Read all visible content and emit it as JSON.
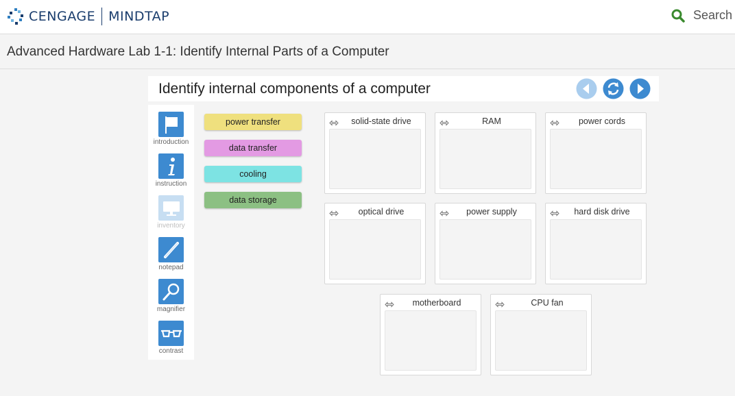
{
  "brand": {
    "name": "CENGAGE",
    "product": "MINDTAP"
  },
  "search": {
    "label": "Search"
  },
  "page": {
    "title": "Advanced Hardware Lab 1-1: Identify Internal Parts of a Computer"
  },
  "activity": {
    "title": "Identify internal components of a computer"
  },
  "tools": [
    {
      "label": "introduction",
      "icon": "flag-icon",
      "enabled": true
    },
    {
      "label": "instruction",
      "icon": "info-icon",
      "enabled": true
    },
    {
      "label": "inventory",
      "icon": "monitor-icon",
      "enabled": false
    },
    {
      "label": "notepad",
      "icon": "pencil-icon",
      "enabled": true
    },
    {
      "label": "magnifier",
      "icon": "magnifier-icon",
      "enabled": true
    },
    {
      "label": "contrast",
      "icon": "glasses-icon",
      "enabled": true
    }
  ],
  "categories": [
    {
      "label": "power transfer",
      "color": "#efe07e"
    },
    {
      "label": "data transfer",
      "color": "#e39ae3"
    },
    {
      "label": "cooling",
      "color": "#7de3e3"
    },
    {
      "label": "data storage",
      "color": "#8cc083"
    }
  ],
  "components": [
    {
      "label": "solid-state drive"
    },
    {
      "label": "RAM"
    },
    {
      "label": "power cords"
    },
    {
      "label": "optical drive"
    },
    {
      "label": "power supply"
    },
    {
      "label": "hard disk drive"
    },
    {
      "label": "motherboard"
    },
    {
      "label": "CPU fan"
    }
  ],
  "colors": {
    "brand_navy": "#1a3d6d",
    "accent_blue": "#3d8ad0",
    "search_green": "#3a8a2e",
    "nav_disabled": "#a9cdee"
  }
}
